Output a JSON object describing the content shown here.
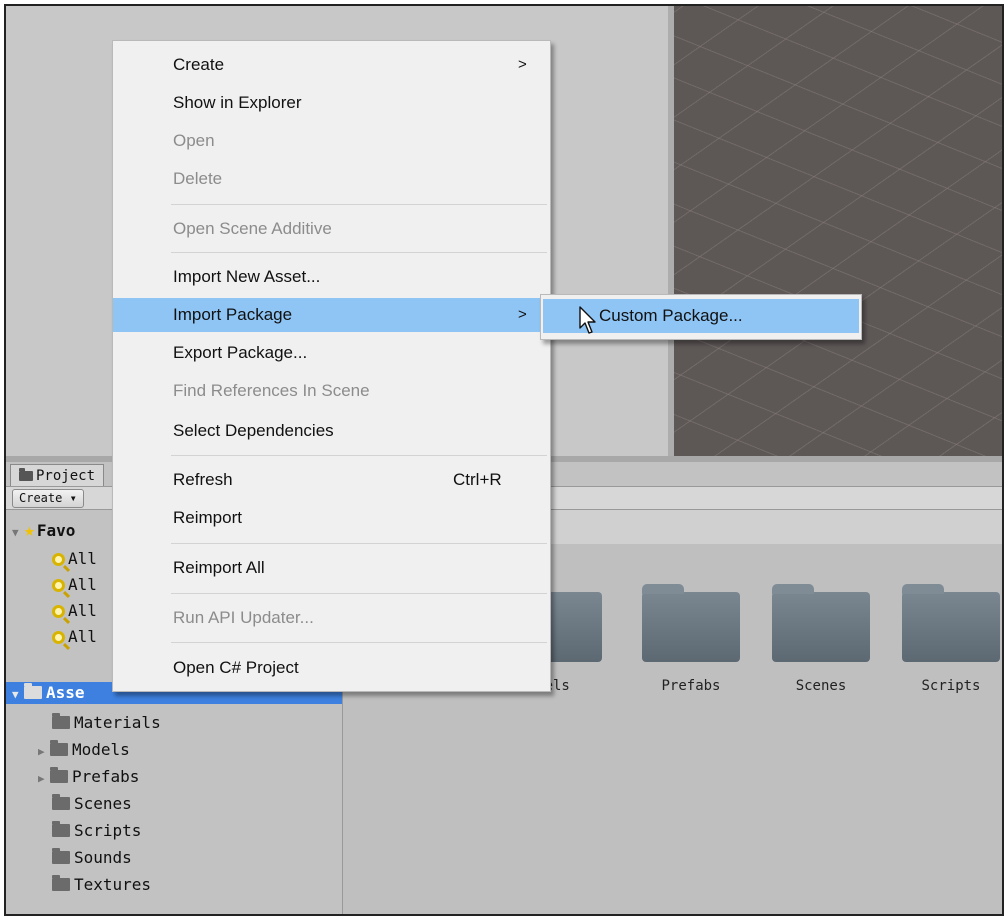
{
  "project_panel": {
    "tab_label": "Project",
    "create_button": "Create ▾",
    "favorites": {
      "label": "Favorites",
      "visible_label": "Favo",
      "items": [
        "All",
        "All",
        "All",
        "All"
      ]
    },
    "assets_root": "Assets",
    "assets_visible": "Asse",
    "tree_items": [
      {
        "label": "Materials",
        "has_children": false
      },
      {
        "label": "Models",
        "has_children": true
      },
      {
        "label": "Prefabs",
        "has_children": true
      },
      {
        "label": "Scenes",
        "has_children": false
      },
      {
        "label": "Scripts",
        "has_children": false
      },
      {
        "label": "Sounds",
        "has_children": false
      },
      {
        "label": "Textures",
        "has_children": false
      }
    ],
    "grid_folders": [
      "dels",
      "Prefabs",
      "Scenes",
      "Scripts"
    ]
  },
  "context_menu": {
    "items": [
      {
        "label": "Create",
        "submenu": true
      },
      {
        "label": "Show in Explorer"
      },
      {
        "label": "Open",
        "disabled": true
      },
      {
        "label": "Delete",
        "disabled": true
      },
      {
        "label": "Open Scene Additive",
        "disabled": true
      },
      {
        "label": "Import New Asset..."
      },
      {
        "label": "Import Package",
        "submenu": true,
        "highlighted": true
      },
      {
        "label": "Export Package..."
      },
      {
        "label": "Find References In Scene",
        "disabled": true
      },
      {
        "label": "Select Dependencies"
      },
      {
        "label": "Refresh",
        "shortcut": "Ctrl+R"
      },
      {
        "label": "Reimport"
      },
      {
        "label": "Reimport All"
      },
      {
        "label": "Run API Updater...",
        "disabled": true
      },
      {
        "label": "Open C# Project"
      }
    ],
    "submenu_arrow": ">"
  },
  "import_package_submenu": {
    "items": [
      {
        "label": "Custom Package...",
        "highlighted": true
      }
    ]
  },
  "colors": {
    "menu_highlight": "#8ec5f5",
    "selection": "#3d80df",
    "disabled_text": "#8c8c8c"
  }
}
